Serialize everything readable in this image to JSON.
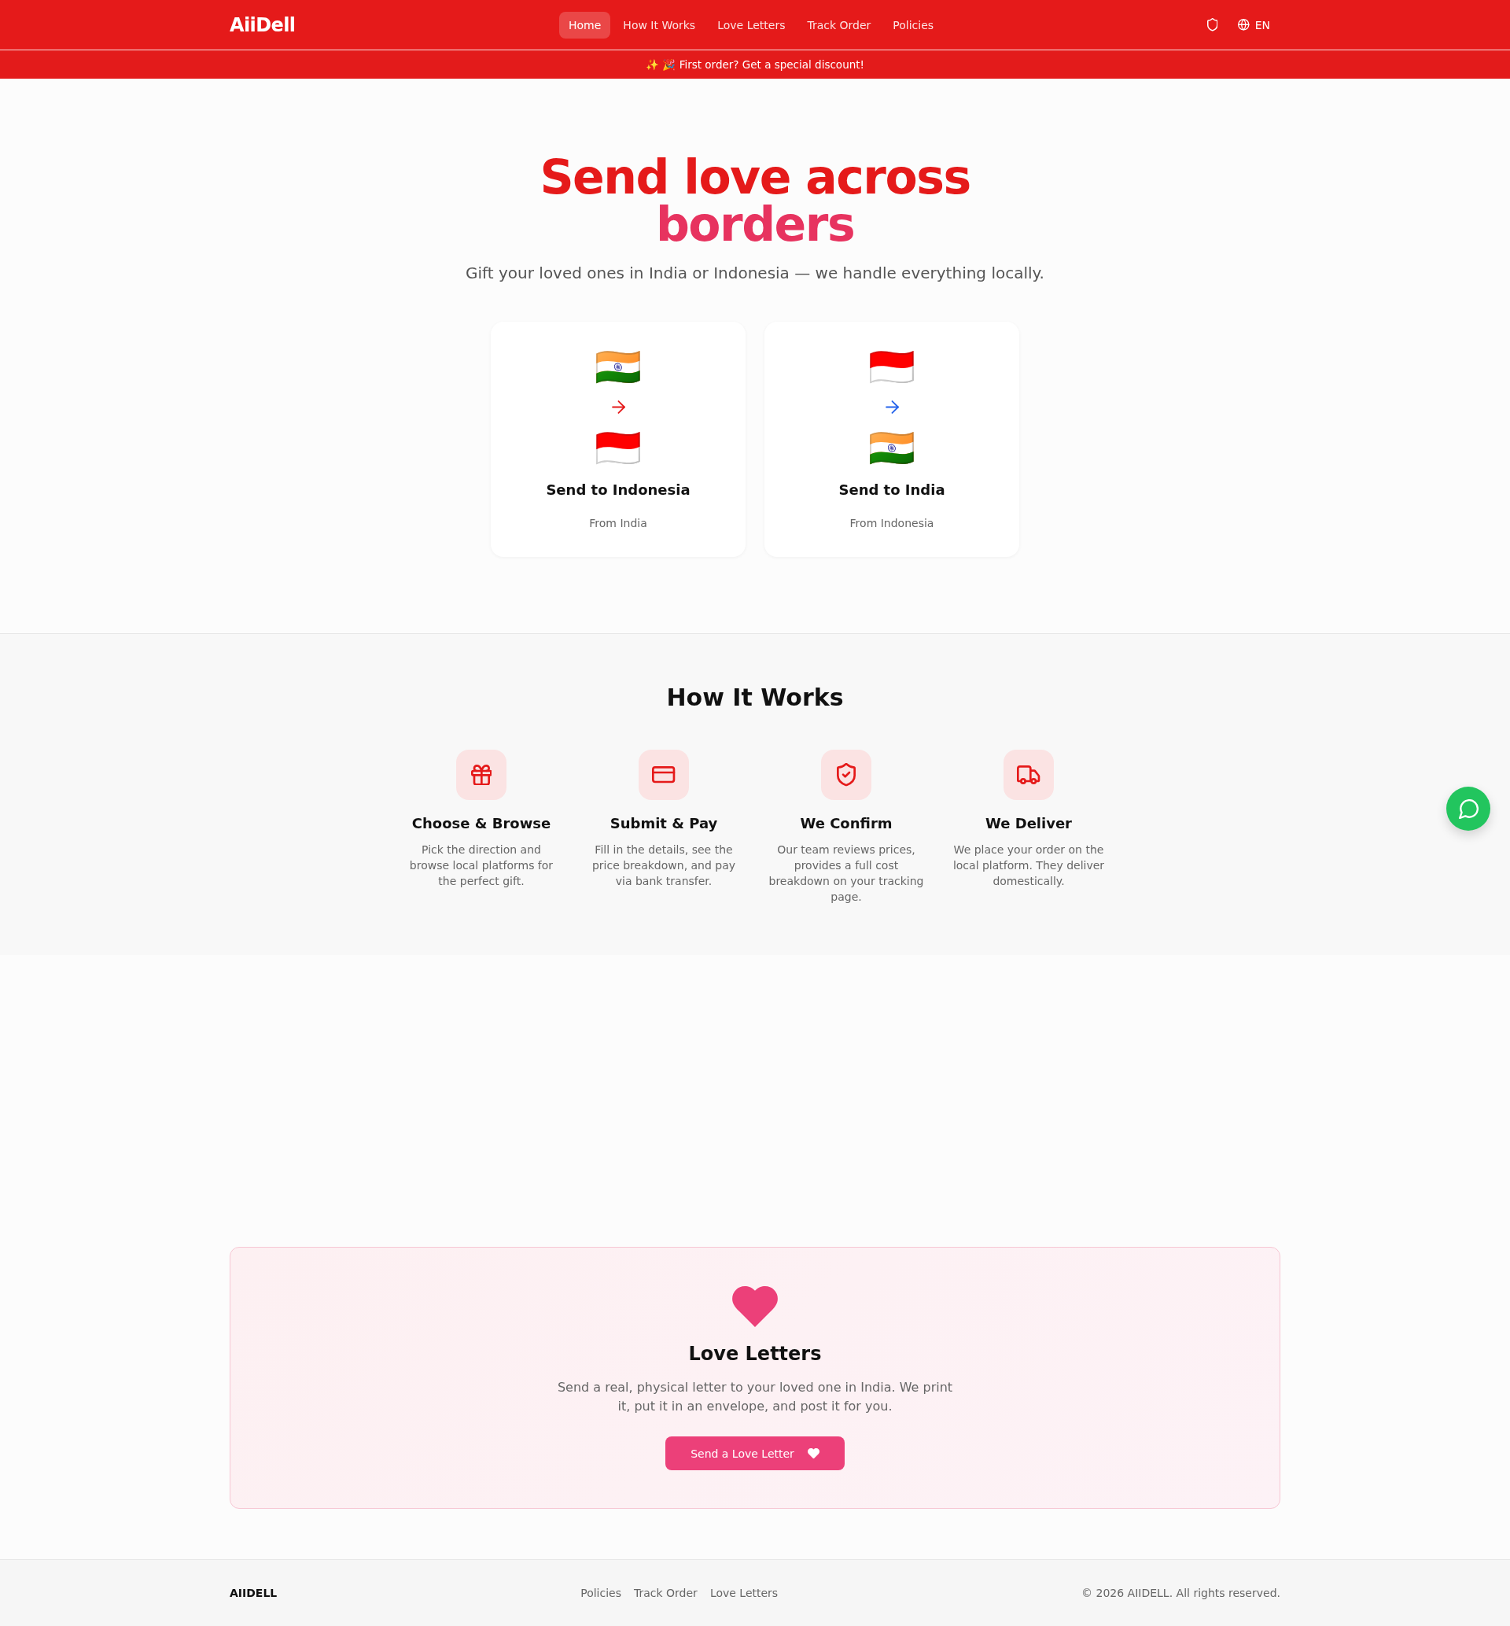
{
  "header": {
    "logo": "AiiDell",
    "nav": [
      {
        "label": "Home",
        "selected": true
      },
      {
        "label": "How It Works",
        "selected": false
      },
      {
        "label": "Love Letters",
        "selected": false
      },
      {
        "label": "Track Order",
        "selected": false
      },
      {
        "label": "Policies",
        "selected": false
      }
    ],
    "language": "EN"
  },
  "promo_banner": {
    "text": "✨ 🎉 First order? Get a special discount!"
  },
  "hero": {
    "title": "Send love across",
    "title_accent": "borders",
    "subtitle": "Gift your loved ones in India or Indonesia — we handle everything locally.",
    "cards": [
      {
        "from_flag": "🇮🇳",
        "to_flag": "🇮🇩",
        "color": "#e51a1a",
        "title": "Send to Indonesia",
        "subtitle": "From India"
      },
      {
        "from_flag": "🇮🇩",
        "to_flag": "🇮🇳",
        "color": "#2563eb",
        "title": "Send to India",
        "subtitle": "From Indonesia"
      }
    ]
  },
  "how_it_works": {
    "title": "How It Works",
    "steps": [
      {
        "title": "Choose & Browse",
        "description": "Pick the direction and browse local platforms for the perfect gift."
      },
      {
        "title": "Submit & Pay",
        "description": "Fill in the details, see the price breakdown, and pay via bank transfer."
      },
      {
        "title": "We Confirm",
        "description": "Our team reviews prices, provides a full cost breakdown on your tracking page."
      },
      {
        "title": "We Deliver",
        "description": "We place your order on the local platform. They deliver domestically."
      }
    ]
  },
  "love_letters": {
    "title": "Love Letters",
    "description": "Send a real, physical letter to your loved one in India. We print it, put it in an envelope, and post it for you.",
    "button": "Send a Love Letter"
  },
  "footer": {
    "brand": "AIIDELL",
    "links": [
      "Policies",
      "Track Order",
      "Love Letters"
    ],
    "copyright": "© 2026 AIIDELL. All rights reserved."
  }
}
